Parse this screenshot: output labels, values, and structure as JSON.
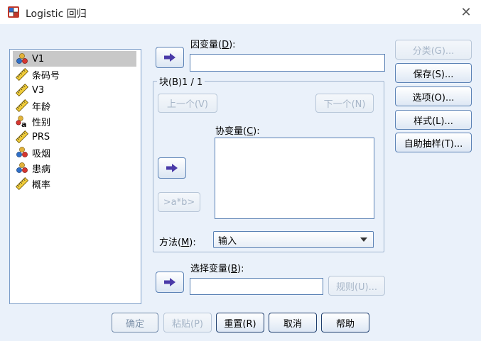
{
  "window": {
    "title": "Logistic 回归"
  },
  "variables": [
    {
      "label": "V1",
      "icon": "nominal-icon",
      "selected": true
    },
    {
      "label": "条码号",
      "icon": "scale-icon"
    },
    {
      "label": "V3",
      "icon": "scale-icon"
    },
    {
      "label": "年龄",
      "icon": "scale-icon"
    },
    {
      "label": "性别",
      "icon": "string-nominal-icon"
    },
    {
      "label": "PRS",
      "icon": "scale-icon"
    },
    {
      "label": "吸烟",
      "icon": "nominal-icon"
    },
    {
      "label": "患病",
      "icon": "nominal-icon"
    },
    {
      "label": "概率",
      "icon": "scale-icon"
    }
  ],
  "dependent": {
    "label": "因变量(",
    "mnemonic": "D",
    "label_end": "):",
    "value": ""
  },
  "block": {
    "title": "块(B)1 / 1",
    "prev": "上一个(V)",
    "next": "下一个(N)"
  },
  "covariates": {
    "label": "协变量(",
    "mnemonic": "C",
    "label_end": "):",
    "interaction": ">a*b>"
  },
  "method": {
    "label": "方法(",
    "mnemonic": "M",
    "label_end": "):",
    "value": "输入"
  },
  "selection": {
    "label": "选择变量(",
    "mnemonic": "B",
    "label_end": "):",
    "rule": "规则(U)..."
  },
  "side_buttons": {
    "classify": "分类(G)...",
    "save": "保存(S)...",
    "options": "选项(O)...",
    "style": "样式(L)...",
    "bootstrap": "自助抽样(T)..."
  },
  "bottom_buttons": {
    "ok": "确定",
    "paste": "粘贴(P)",
    "reset": "重置(R)",
    "cancel": "取消",
    "help": "帮助"
  },
  "colors": {
    "accent": "#5b82b5",
    "background": "#eaf1fa",
    "arrow": "#4a3aa8"
  }
}
